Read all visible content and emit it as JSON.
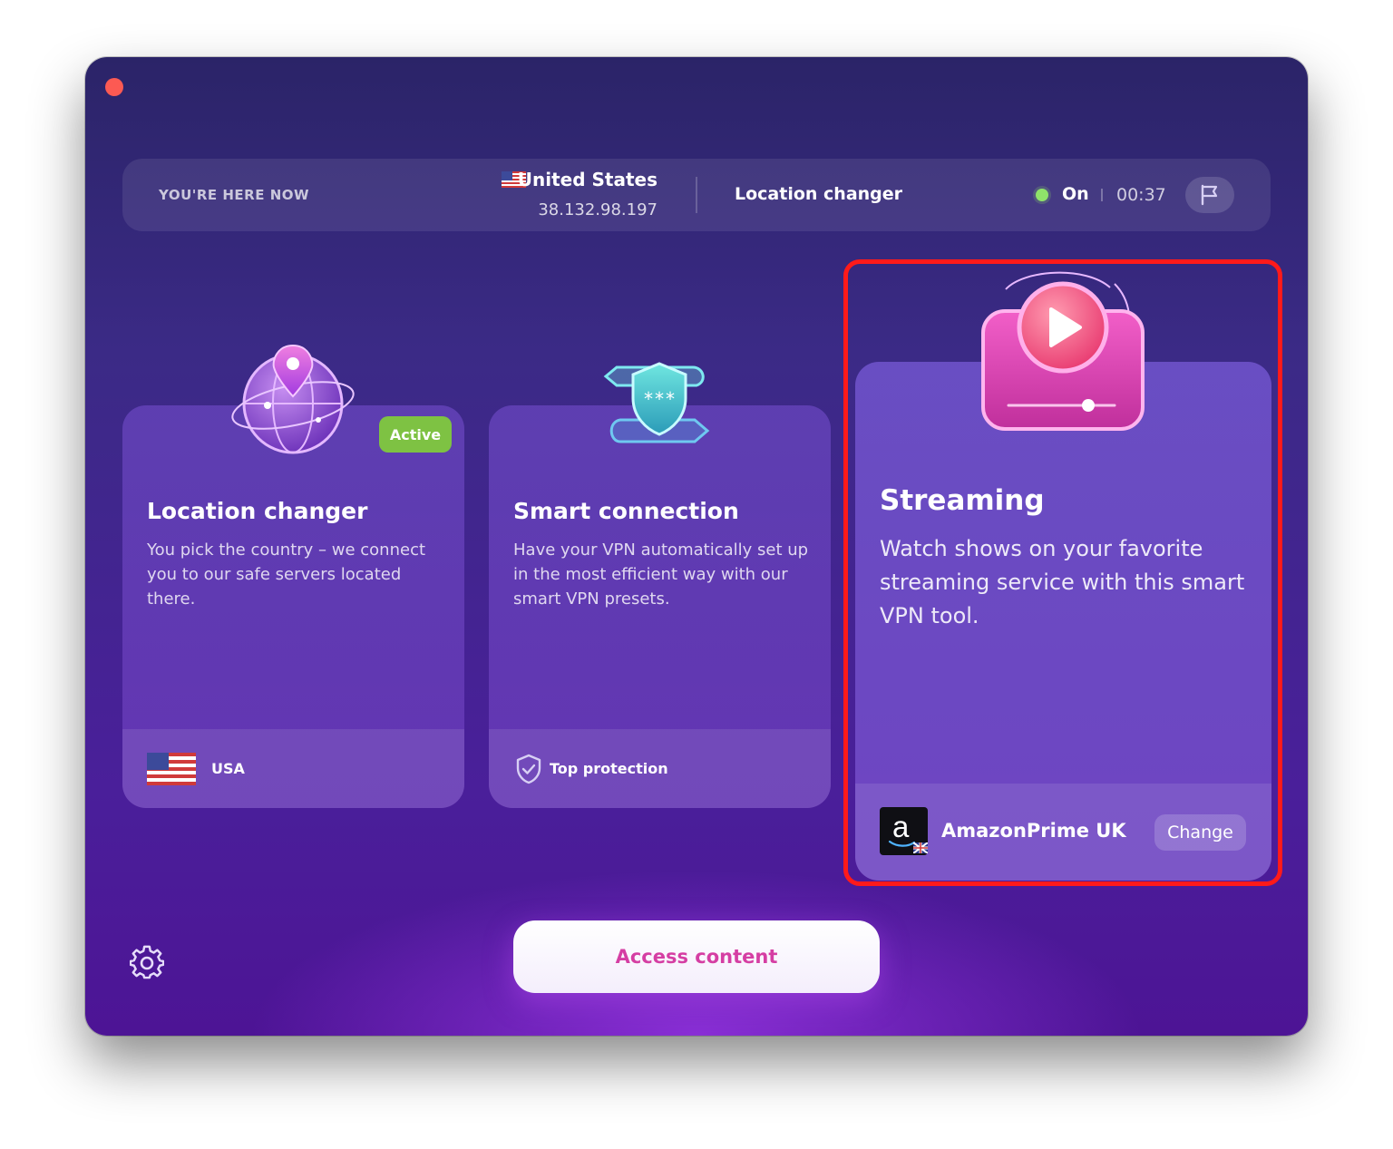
{
  "topbar": {
    "here_label": "YOU'RE HERE NOW",
    "country": "United States",
    "ip": "38.132.98.197",
    "mode": "Location changer",
    "status": "On",
    "timer": "00:37",
    "flag_icon": "flag-icon"
  },
  "cards": [
    {
      "title": "Location changer",
      "description": "You pick the country – we connect you to our safe servers located there.",
      "badge": "Active",
      "footer_label": "USA",
      "icon": "globe-pin-icon"
    },
    {
      "title": "Smart connection",
      "description": "Have your VPN automatically set up in the most efficient way with our smart VPN presets.",
      "footer_label": "Top protection",
      "icon": "shield-icon"
    },
    {
      "title": "Streaming",
      "description": "Watch shows on your favorite streaming service with this smart VPN tool.",
      "service_name": "AmazonPrime UK",
      "service_logo_letter": "a",
      "change_label": "Change",
      "icon": "play-icon"
    }
  ],
  "access_button": "Access content",
  "colors": {
    "accent": "#d53ea3",
    "status_on": "#8fe36a",
    "badge": "#7ec243",
    "highlight": "#ff1a1a"
  }
}
